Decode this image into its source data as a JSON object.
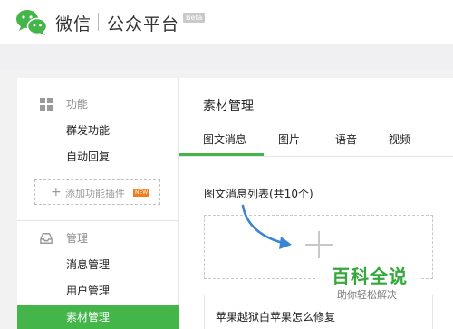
{
  "header": {
    "brand_name": "微信",
    "brand_sub": "公众平台",
    "beta_badge": "Beta"
  },
  "sidebar": {
    "sections": [
      {
        "label": "功能",
        "icon": "grid-icon"
      },
      {
        "label": "管理",
        "icon": "inbox-icon"
      }
    ],
    "function_items": [
      "群发功能",
      "自动回复"
    ],
    "add_plugin": {
      "label": "添加功能插件",
      "badge": "NEW"
    },
    "manage_items": [
      "消息管理",
      "用户管理",
      "素材管理"
    ],
    "active_item": "素材管理"
  },
  "main": {
    "title": "素材管理",
    "tabs": [
      "图文消息",
      "图片",
      "语音",
      "视频"
    ],
    "active_tab": "图文消息",
    "list_title": "图文消息列表(共10个)",
    "article_title": "苹果越狱白苹果怎么修复"
  },
  "watermark": {
    "main": "百科全说",
    "sub": "助你轻松解决"
  },
  "colors": {
    "accent_green": "#44b549",
    "arrow_blue": "#3a85d4",
    "watermark_green": "#35a83c",
    "new_badge_orange": "#f37b1d"
  }
}
